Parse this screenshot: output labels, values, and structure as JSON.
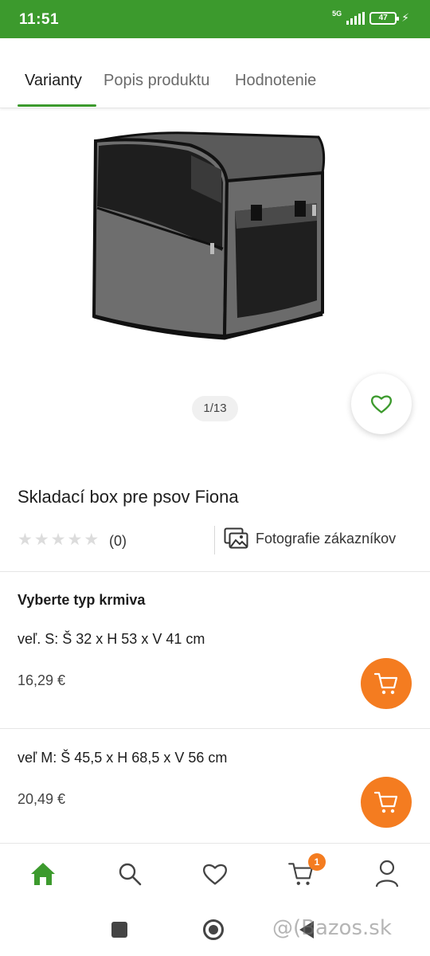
{
  "status_bar": {
    "time": "11:51",
    "network": "5G",
    "battery": "47"
  },
  "tabs": [
    {
      "label": "Varianty",
      "active": true
    },
    {
      "label": "Popis produktu",
      "active": false
    },
    {
      "label": "Hodnotenie",
      "active": false
    }
  ],
  "gallery": {
    "counter": "1/13"
  },
  "product": {
    "title": "Skladací box pre psov Fiona",
    "review_count": "(0)",
    "stars_filled": 0,
    "stars_total": 5,
    "customer_photos_label": "Fotografie zákazníkov"
  },
  "variants_section": {
    "label": "Vyberte typ krmiva",
    "items": [
      {
        "name": "veľ. S: Š 32 x H 53 x V 41 cm",
        "price": "16,29 €"
      },
      {
        "name": "veľ M: Š 45,5 x H 68,5 x V 56 cm",
        "price": "20,49 €"
      }
    ]
  },
  "bottom_nav": {
    "cart_badge": "1",
    "items": [
      "home-icon",
      "search-icon",
      "heart-icon",
      "cart-icon",
      "user-icon"
    ]
  },
  "watermark": "@(Bazos.sk",
  "colors": {
    "brand_green": "#3c9a2d",
    "accent_orange": "#f47c20"
  }
}
